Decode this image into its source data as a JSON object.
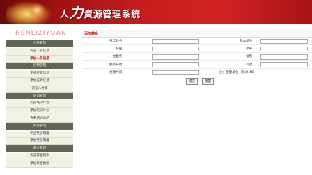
{
  "header": {
    "title_big": "力",
    "title_left": "人",
    "title_right": "資源管理系統"
  },
  "sidebar": {
    "brand": "RENLIZIYUAN",
    "sections": [
      {
        "title": "人员管理",
        "items": [
          "浏览人员信息",
          "添加人员信息"
        ]
      },
      {
        "title": "招聘管理",
        "items": [
          "浏览应聘信息",
          "添加应聘信息",
          "浏览人才库"
        ]
      },
      {
        "title": "培训管理",
        "items": [
          "浏览培训计划",
          "添加培训计划",
          "查看培训总结"
        ]
      },
      {
        "title": "奖惩管理",
        "items": [
          "浏览奖惩制度",
          "添加奖惩制度"
        ]
      },
      {
        "title": "薪金管理",
        "items": [
          "浏览薪金列表",
          "添加薪金数据"
        ]
      }
    ],
    "active_item": "添加人员信息"
  },
  "main": {
    "title": "添加薪金",
    "form": {
      "employee_name_label": "员工姓名：",
      "employee_name_value": "",
      "base_salary_label": "基本薪金：",
      "base_salary_value": "",
      "allowance_label": "补贴：",
      "allowance_value": "",
      "subsidy_label": "损补：",
      "subsidy_value": "",
      "bonus_label": "全勤奖：",
      "bonus_value": "",
      "insurance_label": "福利：",
      "insurance_value": "",
      "extra_label": "额外补助：",
      "extra_value": "",
      "deduction_label": "罚款：",
      "deduction_value": "",
      "time_label": "发放时间：",
      "time_value": "",
      "note": "注：金额单位（元/RMB）"
    },
    "buttons": {
      "submit": "提交",
      "reset": "重置"
    }
  }
}
